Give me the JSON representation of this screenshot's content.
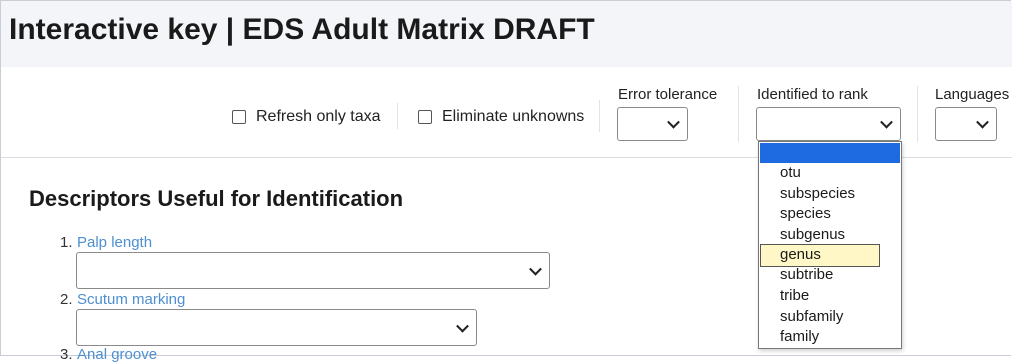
{
  "header": {
    "title": "Interactive key | EDS Adult Matrix DRAFT"
  },
  "toolbar": {
    "refresh_only_taxa": "Refresh only taxa",
    "eliminate_unknowns": "Eliminate unknowns",
    "error_tolerance_label": "Error tolerance",
    "identified_to_rank_label": "Identified to rank",
    "languages_label": "Languages"
  },
  "main": {
    "section_title": "Descriptors Useful for Identification",
    "descriptors": [
      {
        "number": "1.",
        "label": "Palp length"
      },
      {
        "number": "2.",
        "label": "Scutum marking"
      },
      {
        "number": "3.",
        "label": "Anal groove"
      }
    ]
  },
  "rank_dropdown": {
    "options": [
      "otu",
      "subspecies",
      "species",
      "subgenus",
      "genus",
      "subtribe",
      "tribe",
      "subfamily",
      "family"
    ],
    "highlighted": "genus",
    "blank_selected": true
  },
  "colors": {
    "link": "#4d8fd1",
    "selected": "#1e6ae0",
    "hover": "#fff7c6",
    "header_bg": "#f3f5f8"
  }
}
